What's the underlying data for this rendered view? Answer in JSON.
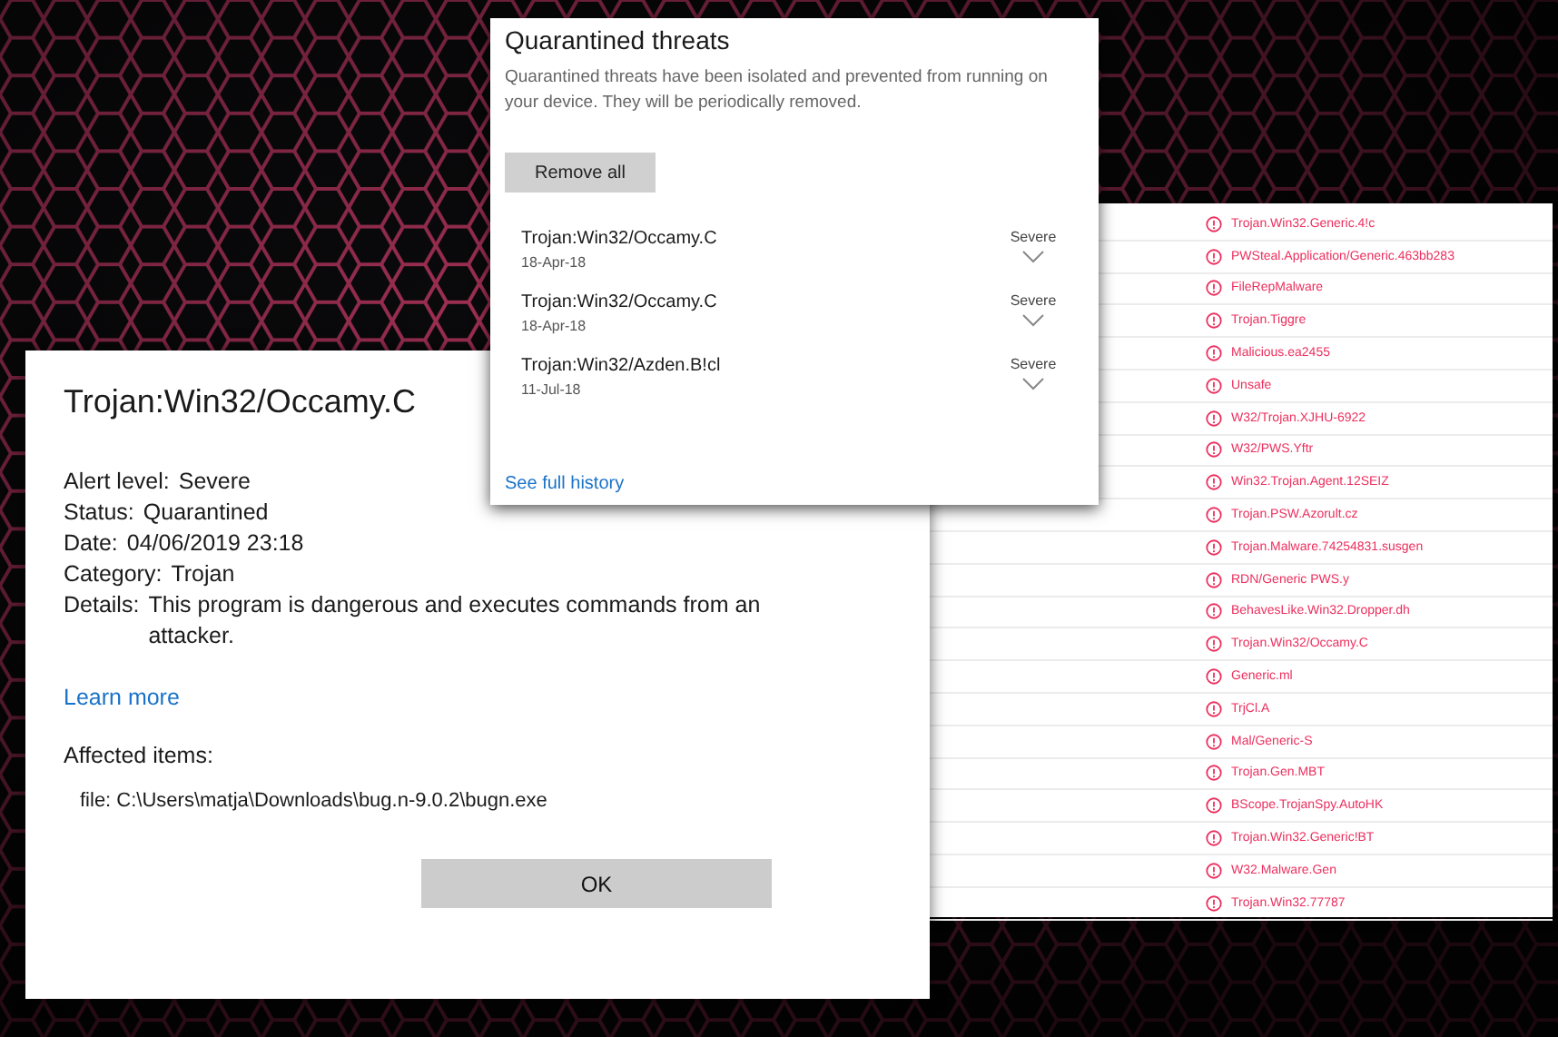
{
  "detections": [
    "Trojan.Win32.Generic.4!c",
    "PWSteal.Application/Generic.463bb283",
    "FileRepMalware",
    "Trojan.Tiggre",
    "Malicious.ea2455",
    "Unsafe",
    "W32/Trojan.XJHU-6922",
    "W32/PWS.Yftr",
    "Win32.Trojan.Agent.12SEIZ",
    "Trojan.PSW.Azorult.cz",
    "Trojan.Malware.74254831.susgen",
    "RDN/Generic PWS.y",
    "BehavesLike.Win32.Dropper.dh",
    "Trojan.Win32/Occamy.C",
    "Generic.ml",
    "TrjCl.A",
    "Mal/Generic-S",
    "Trojan.Gen.MBT",
    "BScope.TrojanSpy.AutoHK",
    "Trojan.Win32.Generic!BT",
    "W32.Malware.Gen",
    "Trojan.Win32.77787"
  ],
  "alert": {
    "title": "Trojan:Win32/Occamy.C",
    "fields": [
      {
        "label": "Alert level:",
        "value": "Severe"
      },
      {
        "label": "Status:",
        "value": "Quarantined"
      },
      {
        "label": "Date:",
        "value": "04/06/2019 23:18"
      },
      {
        "label": "Category:",
        "value": "Trojan"
      },
      {
        "label": "Details:",
        "value": "This program is dangerous and executes commands from an attacker."
      }
    ],
    "learn_more": "Learn more",
    "affected_label": "Affected items:",
    "affected_item": "file: C:\\Users\\matja\\Downloads\\bug.n-9.0.2\\bugn.exe",
    "ok_button": "OK"
  },
  "quarantine": {
    "title": "Quarantined threats",
    "description": "Quarantined threats have been isolated and prevented from running on your device.  They will be periodically removed.",
    "remove_button": "Remove all",
    "threats": [
      {
        "name": "Trojan:Win32/Occamy.C",
        "date": "18-Apr-18",
        "severity": "Severe"
      },
      {
        "name": "Trojan:Win32/Occamy.C",
        "date": "18-Apr-18",
        "severity": "Severe"
      },
      {
        "name": "Trojan:Win32/Azden.B!cl",
        "date": "11-Jul-18",
        "severity": "Severe"
      }
    ],
    "history_link": "See full history"
  }
}
